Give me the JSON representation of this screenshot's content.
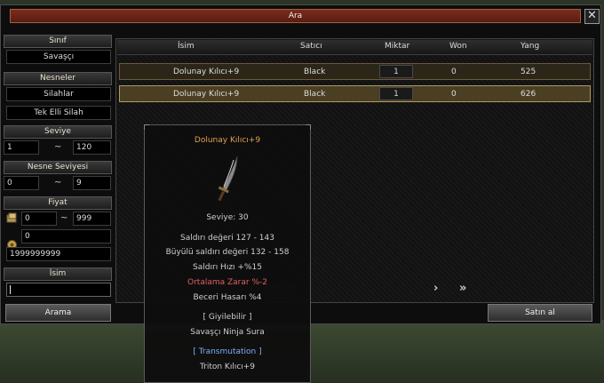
{
  "window": {
    "title": "Ara",
    "close": "✕"
  },
  "sidebar": {
    "class_label": "Sınıf",
    "class_value": "Savaşçı",
    "items_label": "Nesneler",
    "items_value": "Silahlar",
    "subtype_value": "Tek Elli Silah",
    "level_label": "Seviye",
    "level_min": "1",
    "level_max": "120",
    "item_level_label": "Nesne Seviyesi",
    "item_level_min": "0",
    "item_level_max": "9",
    "price_label": "Fiyat",
    "price_min": "0",
    "price_max": "999",
    "price_won": "0",
    "price_yang": "1999999999",
    "name_label": "İsim",
    "name_value": "",
    "tilde": "~",
    "search_button": "Arama"
  },
  "table": {
    "columns": [
      "İsim",
      "Satıcı",
      "Miktar",
      "Won",
      "Yang"
    ],
    "rows": [
      {
        "name": "Dolunay Kılıcı+9",
        "seller": "Black",
        "qty": "1",
        "won": "0",
        "yang": "525"
      },
      {
        "name": "Dolunay Kılıcı+9",
        "seller": "Black",
        "qty": "1",
        "won": "0",
        "yang": "626"
      }
    ],
    "page": "1",
    "next": "›",
    "last": "»"
  },
  "buy_button": "Satın al",
  "tooltip": {
    "title": "Dolunay Kılıcı+9",
    "level": "Seviye: 30",
    "attack": "Saldırı değeri 127 - 143",
    "magic_attack": "Büyülü saldırı değeri 132 - 158",
    "attack_speed": "Saldırı Hızı +%15",
    "avg_damage": "Ortalama Zarar %-2",
    "skill_damage": "Beceri Hasarı %4",
    "wearable": "[ Giyilebilir ]",
    "classes": "Savaşçı Ninja Sura",
    "transmutation": "[ Transmutation ]",
    "transmute_item": "Triton Kılıcı+9"
  },
  "colors": {
    "title_orange": "#e0a050",
    "red_stat": "#e06060",
    "blue": "#7ab0ff"
  }
}
